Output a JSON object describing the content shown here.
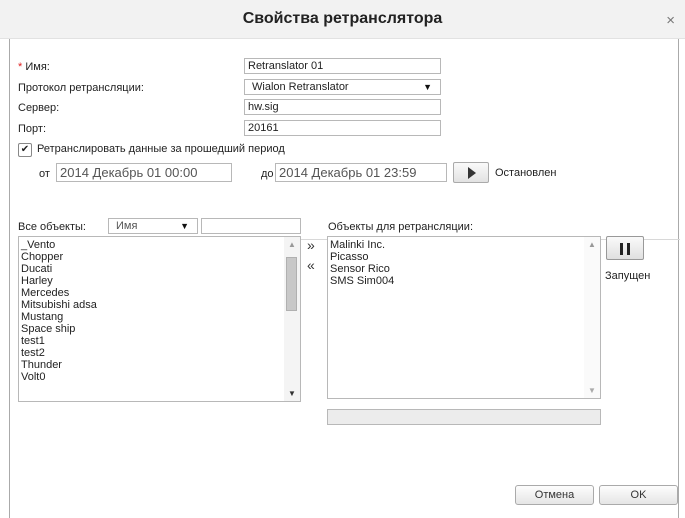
{
  "dialog": {
    "title": "Свойства ретранслятора",
    "close_symbol": "×"
  },
  "form": {
    "name_required_mark": "*",
    "name_label": "Имя:",
    "name_value": "Retranslator 01",
    "protocol_label": "Протокол ретрансляции:",
    "protocol_value": "Wialon Retranslator",
    "server_label": "Сервер:",
    "server_value": "hw.sig",
    "port_label": "Порт:",
    "port_value": "20161"
  },
  "period": {
    "checked": true,
    "check_symbol": "✔",
    "label": "Ретранслировать данные за прошедший период",
    "from_label": "от",
    "from_value": "2014 Декабрь 01 00:00",
    "to_label": "до",
    "to_value": "2014 Декабрь 01 23:59",
    "status": "Остановлен"
  },
  "objects": {
    "all_label": "Все объекты:",
    "filter_select_value": "Имя",
    "filter_input_value": "",
    "all_items": [
      "_Vento",
      "Chopper",
      "Ducati",
      "Harley",
      "Mercedes",
      "Mitsubishi adsa",
      "Mustang",
      "Space ship",
      "test1",
      "test2",
      "Thunder",
      "Volt0"
    ],
    "add_symbol": "»",
    "remove_symbol": "«",
    "retranslate_label": "Объекты для ретрансляции:",
    "retranslate_items": [
      "Malinki Inc.",
      "Picasso",
      "Sensor Rico",
      "SMS Sim004"
    ],
    "running_status": "Запущен",
    "progress": 0
  },
  "footer": {
    "cancel_label": "Отмена",
    "ok_label": "OK"
  },
  "icons": {
    "play": "play-icon",
    "pause": "pause-icon",
    "dropdown": "chevron-down-icon",
    "close": "close-icon",
    "checkbox": "checkmark-icon"
  },
  "colors": {
    "required_mark": "#e02020",
    "title_bar": "#f2f2f2"
  }
}
